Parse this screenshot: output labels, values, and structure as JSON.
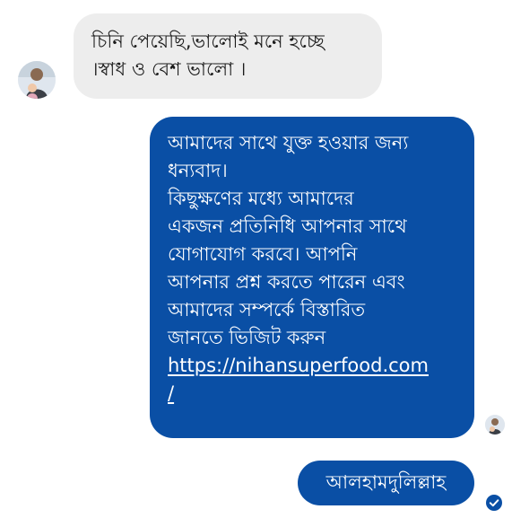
{
  "messages": [
    {
      "sender": "contact",
      "lines": [
        "চিনি পেয়েছি,ভালোই মনে হচ্ছে",
        "।স্বাধ ও বেশ ভালো ।"
      ]
    },
    {
      "sender": "self",
      "lines": [
        "আমাদের সাথে যুক্ত হওয়ার জন্য",
        "ধন্যবাদ।",
        "কিছুক্ষণের মধ্যে আমাদের",
        "একজন প্রতিনিধি আপনার সাথে",
        "যোগাযোগ করবে। আপনি",
        "আপনার প্রশ্ন করতে পারেন এবং",
        "আমাদের সম্পর্কে বিস্তারিত",
        "জানতে ভিজিট করুন"
      ],
      "link_lines": [
        "https://nihansuperfood.com",
        "/"
      ]
    },
    {
      "sender": "self",
      "text": "আলহামদুলিল্লাহ"
    }
  ],
  "colors": {
    "outgoing_bubble": "#0a4fa5",
    "incoming_bubble": "#ededed",
    "read_receipt": "#0a4fa5"
  },
  "icons": {
    "contact_avatar": "user-avatar-icon",
    "seen_avatar": "seen-avatar-icon",
    "read_receipt": "check-circle-icon"
  }
}
